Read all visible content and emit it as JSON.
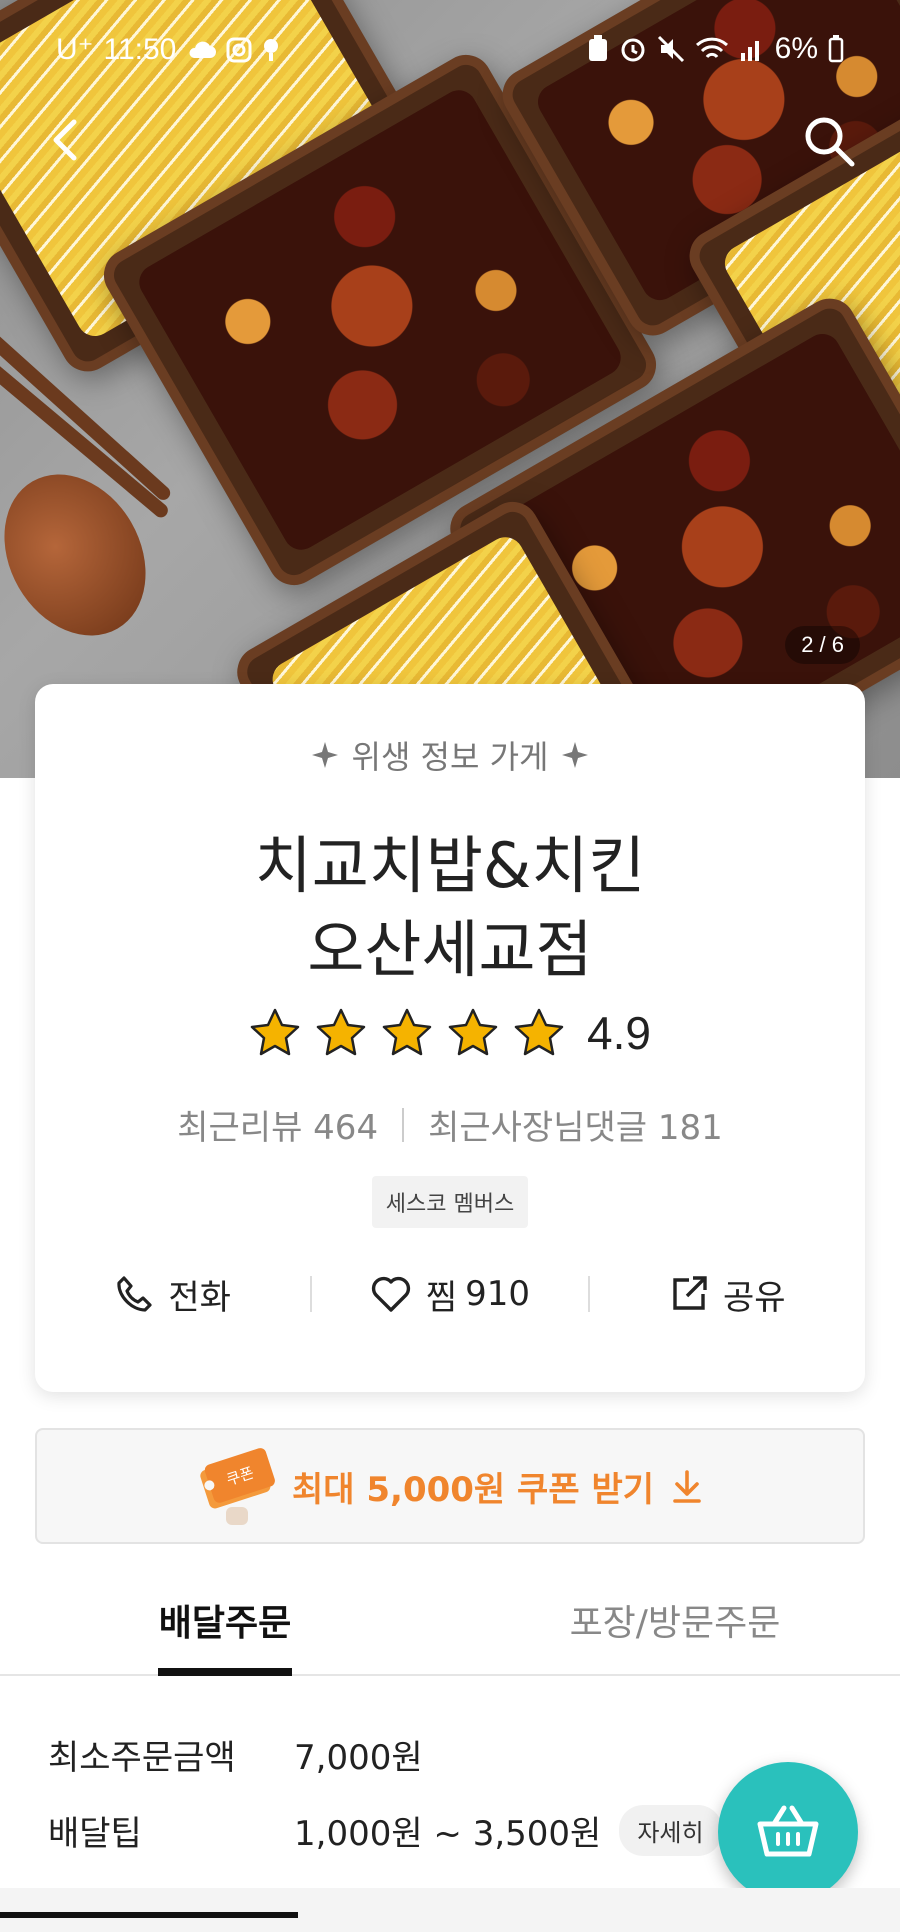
{
  "status_bar": {
    "carrier": "U⁺",
    "time": "11:50",
    "battery": "6%"
  },
  "hero": {
    "page_indicator": "2 / 6"
  },
  "store": {
    "hygiene_label": "위생 정보 가게",
    "name_line1": "치교치밥&치킨",
    "name_line2": "오산세교점",
    "rating": "4.9",
    "stars": 5,
    "recent_reviews": "최근리뷰 464",
    "owner_comments": "최근사장님댓글 181",
    "badge": "세스코 멤버스"
  },
  "actions": {
    "call": "전화",
    "like_label": "찜",
    "like_count": "910",
    "share": "공유"
  },
  "coupon": {
    "ticket_label": "쿠폰",
    "text": "최대 5,000원 쿠폰 받기"
  },
  "tabs": [
    {
      "label": "배달주문",
      "active": true
    },
    {
      "label": "포장/방문주문",
      "active": false
    }
  ],
  "delivery_info": {
    "min_order_label": "최소주문금액",
    "min_order_value": "7,000원",
    "tip_label": "배달팁",
    "tip_value": "1,000원 ~ 3,500원",
    "detail_label": "자세히"
  },
  "colors": {
    "accent_orange": "#f0852d",
    "brand_mint": "#2ac1bc",
    "star": "#f5b300"
  },
  "icons": [
    "back-arrow-icon",
    "search-icon",
    "phone-icon",
    "heart-icon",
    "share-icon",
    "download-arrow-icon",
    "basket-icon",
    "star-icon",
    "sparkle-icon"
  ]
}
